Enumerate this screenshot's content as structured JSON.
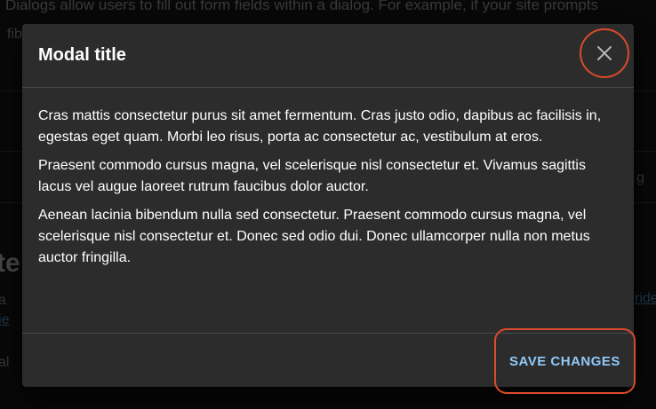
{
  "background": {
    "intro_text": "Dialogs allow users to fill out form fields within a dialog. For example, if your site prompts",
    "intro_text_line2": "fib",
    "fragment_right": "g",
    "heading_fragment": "te",
    "link_fragment_left": "ie",
    "link_fragment_right": "ride",
    "text_fragment_left": "a",
    "text_fragment_left2": "al"
  },
  "dialog": {
    "title": "Modal title",
    "paragraphs": [
      "Cras mattis consectetur purus sit amet fermentum. Cras justo odio, dapibus ac facilisis in, egestas eget quam. Morbi leo risus, porta ac consectetur ac, vestibulum at eros.",
      "Praesent commodo cursus magna, vel scelerisque nisl consectetur et. Vivamus sagittis lacus vel augue laoreet rutrum faucibus dolor auctor.",
      "Aenean lacinia bibendum nulla sed consectetur. Praesent commodo cursus magna, vel scelerisque nisl consectetur et. Donec sed odio dui. Donec ullamcorper nulla non metus auctor fringilla."
    ],
    "save_label": "SAVE CHANGES",
    "close_icon": "close-icon"
  },
  "colors": {
    "accent": "#90caf9",
    "highlight": "#d94b2a",
    "dialog_bg": "#2c2c2c"
  }
}
